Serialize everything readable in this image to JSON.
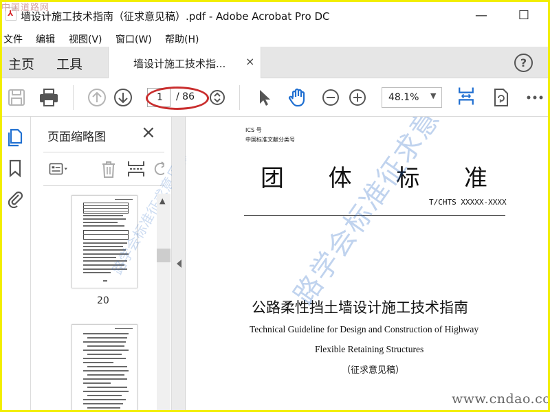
{
  "window": {
    "title": "墙设计施工技术指南（征求意见稿）.pdf - Adobe Acrobat Pro DC",
    "watermark_top": "中国道路网",
    "minimize": "—",
    "maximize": "☐"
  },
  "menu": [
    "文件",
    "编辑",
    "视图(V)",
    "窗口(W)",
    "帮助(H)"
  ],
  "tabs": {
    "home": "主页",
    "tools": "工具",
    "document": "墙设计施工技术指...",
    "close": "×",
    "help": "?"
  },
  "toolbar": {
    "page_current": "1",
    "page_total": "/ 86",
    "zoom": "48.1%"
  },
  "sidebar": {
    "panel_title": "页面缩略图",
    "close": "×",
    "thumbnail_label": "20",
    "watermark": "路学会标准征求意见稿"
  },
  "document": {
    "ics": "ICS 号",
    "classification": "中国标准文献分类号",
    "group_standard_chars": [
      "团",
      "体",
      "标",
      "准"
    ],
    "standard_code": "T/CHTS XXXXX-XXXX",
    "title_cn": "公路柔性挡土墙设计施工技术指南",
    "title_en_1": "Technical Guideline for Design and Construction of Highway",
    "title_en_2": "Flexible Retaining Structures",
    "draft_label": "（征求意见稿）",
    "watermark": "路学会标准征求意见稿"
  },
  "site_watermark": "www.cndao.com",
  "colors": {
    "frame": "#f2ee00",
    "accent_blue": "#1f6fd1",
    "annotation_red": "#c92d2d",
    "tab_bar": "#e6e6e6"
  },
  "icons": {
    "toolbar": [
      "save-icon",
      "print-icon",
      "previous-page-icon",
      "next-page-icon",
      "page-navigation-icon",
      "select-arrow-icon",
      "hand-icon",
      "zoom-out-icon",
      "zoom-in-icon",
      "fit-width-icon",
      "rotate-icon",
      "more-icon"
    ],
    "rail": [
      "page-thumbnails-icon",
      "bookmark-icon",
      "attachment-icon"
    ],
    "thumb_tools": [
      "thumbnail-options-icon",
      "delete-icon",
      "insert-page-icon",
      "undo-icon"
    ]
  }
}
